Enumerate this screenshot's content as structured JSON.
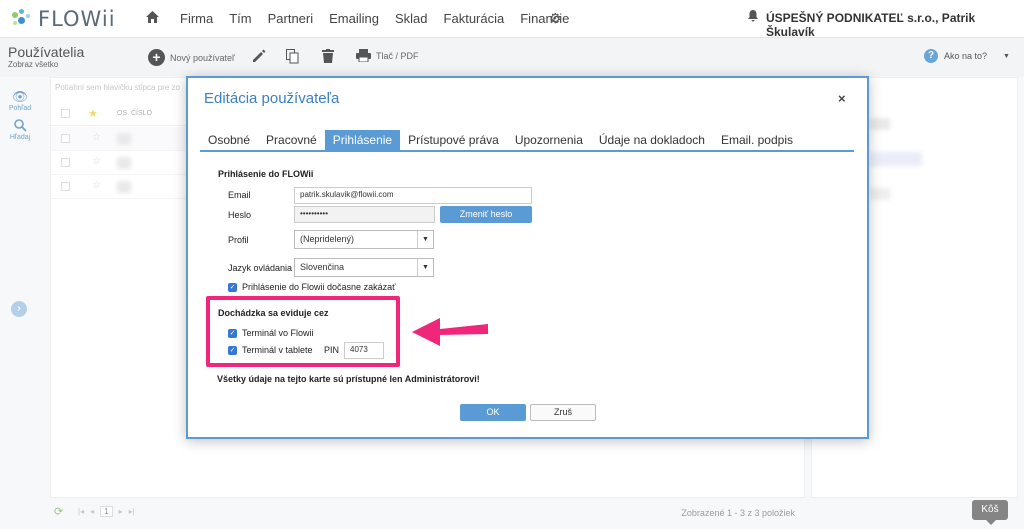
{
  "app": {
    "logo_text": "FLOWii"
  },
  "nav": {
    "items": [
      "Firma",
      "Tím",
      "Partneri",
      "Emailing",
      "Sklad",
      "Fakturácia",
      "Financie"
    ],
    "company": "ÚSPEŠNÝ PODNIKATEĽ s.r.o., Patrik Škulavík"
  },
  "subheader": {
    "title": "Používatelia",
    "subtitle": "Zobraz všetko",
    "new_user": "Nový používateľ",
    "print": "Tlač / PDF",
    "help": "Ako na to?"
  },
  "rail": {
    "view": "Pohľad",
    "search": "Hľadaj"
  },
  "grid": {
    "hint": "Potiahni sem hlavičku stĺpca pre zo",
    "col_number": "OS. ČÍSLO"
  },
  "footer": {
    "page": "1",
    "count": "Zobrazené 1 - 3 z 3 položiek"
  },
  "trash_tooltip": "Kôš",
  "modal": {
    "title": "Editácia používateľa",
    "close": "×",
    "tabs": [
      "Osobné",
      "Pracovné",
      "Prihlásenie",
      "Prístupové práva",
      "Upozornenia",
      "Údaje na dokladoch",
      "Email. podpis"
    ],
    "active_tab": "Prihlásenie",
    "login_section": "Prihlásenie do FLOWii",
    "email_label": "Email",
    "email_value": "patrik.skulavik@flowii.com",
    "password_label": "Heslo",
    "password_value": "••••••••••",
    "change_password": "Zmeniť heslo",
    "profile_label": "Profil",
    "profile_value": "(Nepridelený)",
    "language_label": "Jazyk ovládania",
    "language_value": "Slovenčina",
    "disable_login": "Prihlásenie do Flowii dočasne zakázať",
    "attendance_section": "Dochádzka sa eviduje cez",
    "terminal_flowii": "Terminál vo Flowii",
    "terminal_tablet": "Terminál v tablete",
    "pin_label": "PIN",
    "pin_value": "4073",
    "warning": "Všetky údaje na tejto karte sú prístupné len Administrátorovi!",
    "ok": "OK",
    "cancel": "Zruš"
  },
  "colors": {
    "accent": "#5b9bd5",
    "highlight": "#f0267a",
    "checkbox": "#3478d4"
  }
}
